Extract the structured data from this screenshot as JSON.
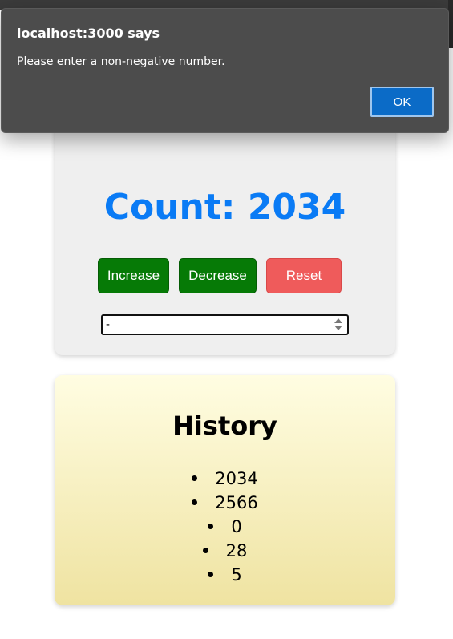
{
  "dialog": {
    "title": "localhost:3000 says",
    "message": "Please enter a non-negative number.",
    "ok_label": "OK"
  },
  "counter": {
    "title": "Count: 2034",
    "buttons": {
      "increase": "Increase",
      "decrease": "Decrease",
      "reset": "Reset"
    },
    "input_value": "-",
    "colors": {
      "title": "#0a7bf5",
      "increase": "#067a06",
      "decrease": "#067a06",
      "reset": "#ef5b5b"
    }
  },
  "history": {
    "title": "History",
    "items": [
      "2034",
      "2566",
      "0",
      "28",
      "5"
    ]
  }
}
